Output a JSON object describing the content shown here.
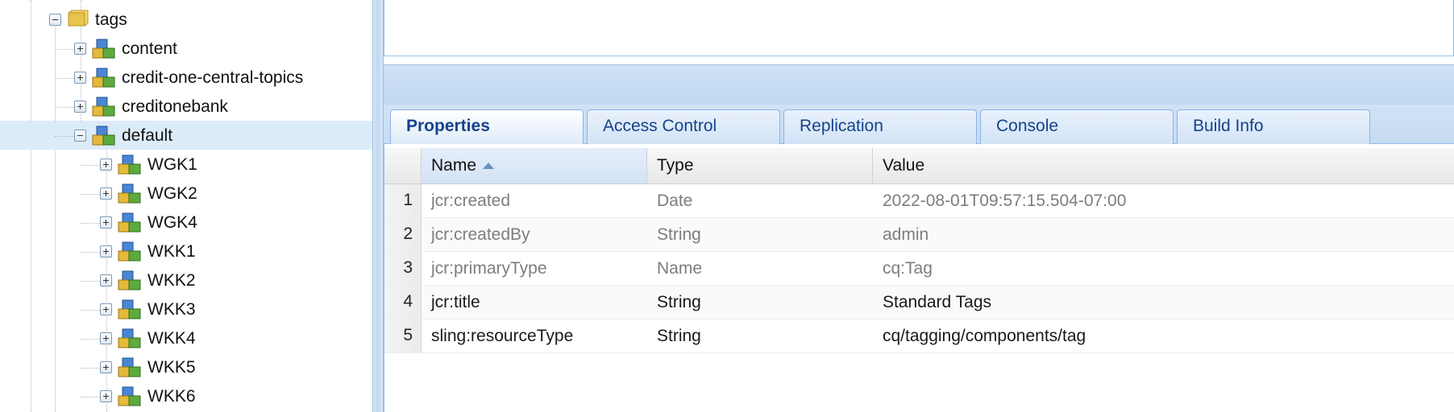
{
  "tree": {
    "root": {
      "label": "tags",
      "expanded": true
    },
    "items": [
      {
        "label": "content",
        "expanded": false,
        "selected": false
      },
      {
        "label": "credit-one-central-topics",
        "expanded": false,
        "selected": false
      },
      {
        "label": "creditonebank",
        "expanded": false,
        "selected": false
      },
      {
        "label": "default",
        "expanded": true,
        "selected": true
      }
    ],
    "children": [
      {
        "label": "WGK1"
      },
      {
        "label": "WGK2"
      },
      {
        "label": "WGK4"
      },
      {
        "label": "WKK1"
      },
      {
        "label": "WKK2"
      },
      {
        "label": "WKK3"
      },
      {
        "label": "WKK4"
      },
      {
        "label": "WKK5"
      },
      {
        "label": "WKK6"
      }
    ]
  },
  "tabs": [
    {
      "label": "Properties",
      "active": true
    },
    {
      "label": "Access Control",
      "active": false
    },
    {
      "label": "Replication",
      "active": false
    },
    {
      "label": "Console",
      "active": false
    },
    {
      "label": "Build Info",
      "active": false
    }
  ],
  "grid": {
    "columns": {
      "name": "Name",
      "type": "Type",
      "value": "Value"
    },
    "sort": {
      "column": "Name",
      "direction": "ascending"
    },
    "rows": [
      {
        "n": "1",
        "name": "jcr:created",
        "type": "Date",
        "value": "2022-08-01T09:57:15.504-07:00",
        "protected": true
      },
      {
        "n": "2",
        "name": "jcr:createdBy",
        "type": "String",
        "value": "admin",
        "protected": true
      },
      {
        "n": "3",
        "name": "jcr:primaryType",
        "type": "Name",
        "value": "cq:Tag",
        "protected": true
      },
      {
        "n": "4",
        "name": "jcr:title",
        "type": "String",
        "value": "Standard Tags",
        "protected": false
      },
      {
        "n": "5",
        "name": "sling:resourceType",
        "type": "String",
        "value": "cq/tagging/components/tag",
        "protected": false
      }
    ]
  },
  "colors": {
    "accent": "#15428b",
    "selection": "#dcebf8",
    "panel_border": "#9cbfe2",
    "protected_text": "#7d7d7d"
  },
  "icons": {
    "folder": "folder-icon",
    "tag": "tag-namespace-icon",
    "expand": "plus-expander-icon",
    "collapse": "minus-expander-icon",
    "sort": "sort-ascending-icon"
  }
}
